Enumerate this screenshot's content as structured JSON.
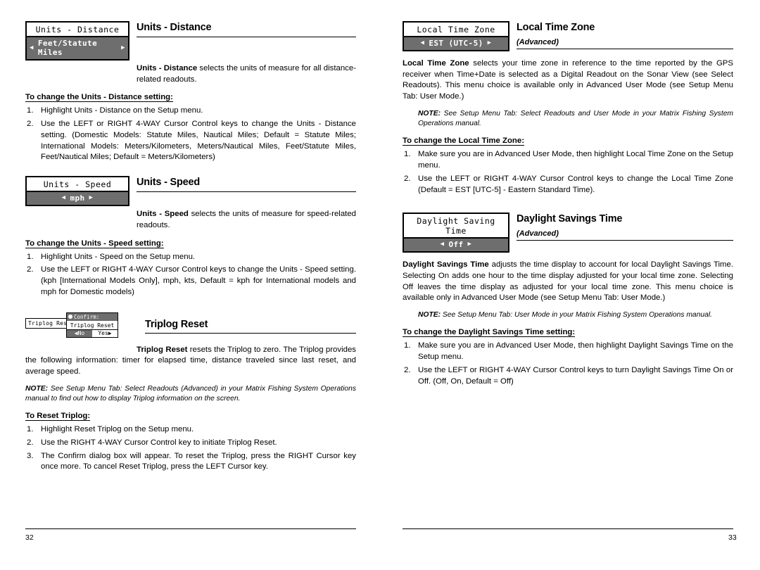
{
  "left_column": {
    "sections": [
      {
        "widget": {
          "title": "Units - Distance",
          "value": "Feet/Statute Miles",
          "left_arrow": "◀",
          "right_arrow": "▶"
        },
        "heading": "Units - Distance",
        "intro_bold": "Units - Distance",
        "intro_rest": " selects the units of measure for all distance-related readouts.",
        "subhead": "To change the Units - Distance setting:",
        "steps": [
          "Highlight Units - Distance on the Setup menu.",
          "Use the LEFT or RIGHT 4-WAY Cursor Control keys to change the Units - Distance setting. (Domestic Models: Statute Miles, Nautical Miles; Default = Statute Miles; International Models: Meters/Kilometers, Meters/Nautical Miles, Feet/Statute Miles, Feet/Nautical Miles; Default = Meters/Kilometers)"
        ]
      },
      {
        "widget": {
          "title": "Units - Speed",
          "value": "mph",
          "left_arrow": "◀",
          "right_arrow": "▶"
        },
        "heading": "Units - Speed",
        "intro_bold": "Units - Speed",
        "intro_rest": " selects the units of measure for speed-related readouts.",
        "subhead": "To change the Units - Speed setting:",
        "steps": [
          "Highlight Units - Speed on the Setup menu.",
          "Use the LEFT or RIGHT 4-WAY Cursor Control keys to change the Units - Speed setting. (kph [International Models Only], mph, kts, Default = kph for International models and mph for Domestic models)"
        ]
      },
      {
        "widget": {
          "back_label": "Triplog Reset",
          "dialog_title": "Confirm:",
          "dialog_mid": "Triplog Reset",
          "btn_no": "◀No",
          "btn_yes": "Yes▶"
        },
        "heading": "Triplog Reset",
        "intro_bold": "Triplog Reset",
        "intro_rest": " resets the Triplog to zero. The Triplog provides the following information: timer for elapsed time, distance traveled since last reset, and average speed.",
        "note_label": "NOTE:",
        "note_text": " See Setup Menu Tab: Select Readouts (Advanced) in your Matrix Fishing System Operations manual to find out how to display Triplog information on the screen.",
        "subhead": "To Reset Triplog:",
        "steps": [
          "Highlight Reset Triplog on the Setup menu.",
          "Use the RIGHT 4-WAY Cursor Control key to initiate Triplog Reset.",
          "The Confirm dialog box will appear. To reset the Triplog, press the RIGHT Cursor key once more. To cancel Reset Triplog, press the LEFT Cursor key."
        ]
      }
    ],
    "page_number": "32"
  },
  "right_column": {
    "sections": [
      {
        "widget": {
          "title": "Local Time Zone",
          "value": "EST ⟨UTC-5⟩",
          "left_arrow": "◀",
          "right_arrow": "▶"
        },
        "heading": "Local Time Zone",
        "advanced": "(Advanced)",
        "intro_bold": "Local Time Zone",
        "intro_rest": " selects your time zone in reference to the time reported by the GPS receiver when Time+Date is selected as a Digital Readout on the Sonar View (see Select Readouts).  This menu choice is available only in Advanced User Mode (see Setup Menu Tab: User Mode.)",
        "note_label": "NOTE:",
        "note_text": " See Setup Menu Tab: Select Readouts and User Mode in your Matrix Fishing System Operations manual.",
        "subhead": "To change the Local Time Zone:",
        "steps": [
          "Make sure you are in Advanced User Mode, then highlight Local Time Zone on the Setup menu.",
          "Use the LEFT or RIGHT 4-WAY Cursor Control keys to change the Local Time Zone (Default = EST [UTC-5] - Eastern Standard Time)."
        ]
      },
      {
        "widget": {
          "title": "Daylight Saving Time",
          "value": "Off",
          "left_arrow": "◀",
          "right_arrow": "▶"
        },
        "heading": "Daylight Savings Time",
        "advanced": "(Advanced)",
        "intro_bold": "Daylight Savings Time",
        "intro_rest": " adjusts the time display to account for local Daylight Savings Time. Selecting On adds one hour to the time display adjusted for your local time zone.  Selecting Off leaves the time display as adjusted for your local time zone. This menu choice is available only in Advanced User Mode (see Setup Menu Tab: User Mode.)",
        "note_label": "NOTE:",
        "note_text": " See Setup Menu Tab: User Mode in your Matrix Fishing System Operations manual.",
        "subhead": "To change the Daylight Savings Time setting:",
        "steps": [
          "Make sure you are in Advanced User Mode, then highlight Daylight Savings Time on the Setup menu.",
          "Use the LEFT or RIGHT 4-WAY Cursor Control keys to turn Daylight Savings Time On or Off. (Off, On, Default = Off)"
        ]
      }
    ],
    "page_number": "33"
  }
}
